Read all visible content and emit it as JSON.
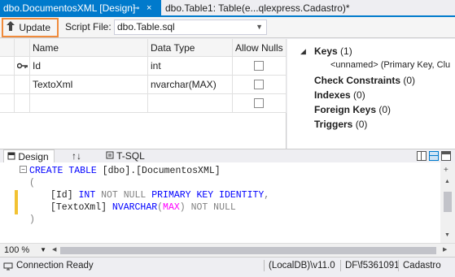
{
  "tabs": {
    "active": {
      "label": "dbo.DocumentosXML [Design]",
      "pin": "⊸",
      "close": "×"
    },
    "inactive": {
      "label": "dbo.Table1: Table(e...qlexpress.Cadastro)*"
    }
  },
  "toolbar": {
    "update_label": "Update",
    "script_file_label": "Script File:",
    "script_file_value": "dbo.Table.sql"
  },
  "grid": {
    "headers": [
      "Name",
      "Data Type",
      "Allow Nulls"
    ],
    "rows": [
      {
        "name": "Id",
        "type": "int",
        "allow_nulls": false,
        "key": true
      },
      {
        "name": "TextoXml",
        "type": "nvarchar(MAX)",
        "allow_nulls": false,
        "key": false
      },
      {
        "name": "",
        "type": "",
        "allow_nulls": false,
        "key": false
      }
    ]
  },
  "side_panel": {
    "keys": {
      "label": "Keys",
      "count": "(1)"
    },
    "keys_item": "<unnamed>  (Primary Key, Clu",
    "check_constraints": {
      "label": "Check Constraints",
      "count": "(0)"
    },
    "indexes": {
      "label": "Indexes",
      "count": "(0)"
    },
    "foreign_keys": {
      "label": "Foreign Keys",
      "count": "(0)"
    },
    "triggers": {
      "label": "Triggers",
      "count": "(0)"
    }
  },
  "pane_tabs": {
    "design": "Design",
    "swap": "↑↓",
    "tsql": "T-SQL"
  },
  "code": {
    "l1_kw": "CREATE TABLE",
    "l1_rest": " [dbo].[DocumentosXML]",
    "l2": "(",
    "l3_col": "[Id]",
    "l3_int": " INT",
    "l3_notnull": " NOT NULL",
    "l3_pk": " PRIMARY KEY IDENTITY",
    "l3_comma": ",",
    "l4_col": "[TextoXml]",
    "l4_type": " NVARCHAR",
    "l4_open": "(",
    "l4_max": "MAX",
    "l4_close": ")",
    "l4_notnull": " NOT NULL",
    "l5": ")"
  },
  "zoom": "100 %",
  "status": {
    "connection": "Connection Ready",
    "server": "(LocalDB)\\v11.0",
    "user": "DF\\f5361091",
    "database": "Cadastro"
  },
  "colors": {
    "accent": "#007acc",
    "highlight": "#f08b3c",
    "change_marker": "#f2c232"
  }
}
